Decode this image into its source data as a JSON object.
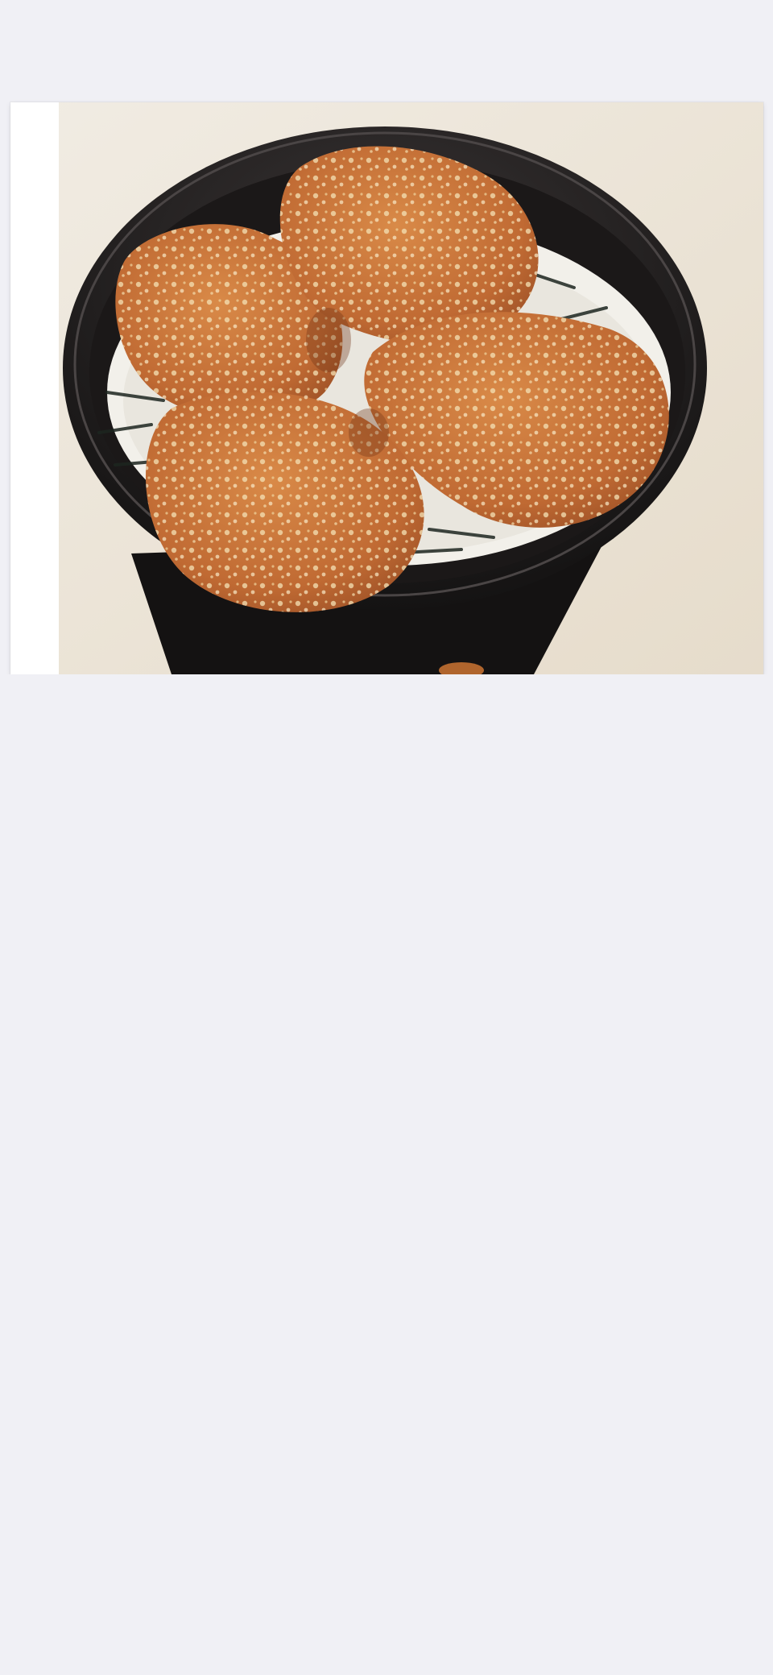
{
  "screen": {
    "background_color": "#f0f0f5"
  },
  "photo": {
    "subject": "fried-chicken-rice-bowl",
    "colors": {
      "backdrop": "#ece4d8",
      "bowl": "#1c1a1a",
      "rice": "#f3f1ec",
      "chicken": "#c8743a",
      "batter_highlight": "#f1d9a8"
    }
  }
}
